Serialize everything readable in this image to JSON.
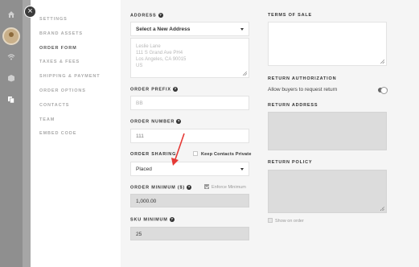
{
  "nav": {
    "items": [
      "SETTINGS",
      "BRAND ASSETS",
      "ORDER FORM",
      "TAXES & FEES",
      "SHIPPING & PAYMENT",
      "ORDER OPTIONS",
      "CONTACTS",
      "TEAM",
      "EMBED CODE"
    ],
    "active": "ORDER FORM"
  },
  "rail_icons": [
    "home-icon",
    "wifi-icon",
    "box-icon",
    "documents-icon"
  ],
  "address": {
    "label": "ADDRESS",
    "select_value": "Select a New Address",
    "lines": [
      "Leslie Lane",
      "111 S Grand Ave PH4",
      "Los Angeles, CA 90015",
      "US"
    ]
  },
  "order_prefix": {
    "label": "ORDER PREFIX",
    "value": "BB"
  },
  "order_number": {
    "label": "ORDER NUMBER",
    "value": "111"
  },
  "order_sharing": {
    "label": "ORDER SHARING",
    "value": "Placed",
    "keep_contacts_label": "Keep Contacts Private",
    "keep_contacts_checked": false
  },
  "order_minimum": {
    "label": "ORDER MINIMUM ($)",
    "value": "1,000.00",
    "enforce_label": "Enforce Minimum",
    "enforce_checked": true
  },
  "sku_minimum": {
    "label": "SKU MINIMUM",
    "value": "25"
  },
  "terms_of_sale": {
    "label": "TERMS OF SALE",
    "value": ""
  },
  "return_authorization": {
    "label": "RETURN AUTHORIZATION",
    "allow_label": "Allow buyers to request return",
    "allow_enabled": true
  },
  "return_address": {
    "label": "RETURN ADDRESS",
    "value": ""
  },
  "return_policy": {
    "label": "RETURN POLICY",
    "value": "",
    "show_on_order_label": "Show on order",
    "show_on_order_checked": false
  },
  "colors": {
    "annotation_arrow": "#e53935",
    "rail": "#8f8f8f",
    "content_bg": "#f5f5f5"
  }
}
